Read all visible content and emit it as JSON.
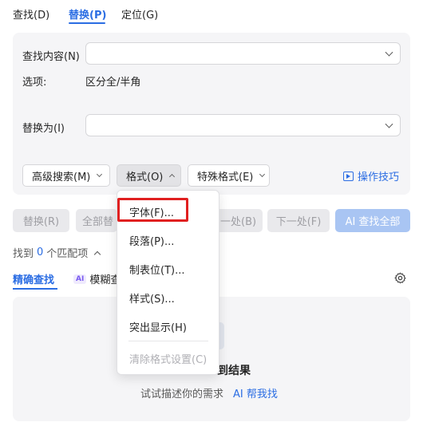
{
  "tabs": [
    {
      "label": "查找(D)"
    },
    {
      "label": "替换(P)"
    },
    {
      "label": "定位(G)"
    }
  ],
  "replace_panel": {
    "find_label": "查找内容(N)",
    "find_value": "",
    "options_label": "选项:",
    "options_value": "区分全/半角",
    "replace_label": "替换为(I)",
    "replace_value": ""
  },
  "toolbar": {
    "advanced_search": "高级搜索(M)",
    "format": "格式(O)",
    "special_format": "特殊格式(E)",
    "tips": "操作技巧"
  },
  "actions": {
    "replace": "替换(R)",
    "replace_all_partial": "全部替",
    "prev_partial": "一处(B)",
    "next": "下一处(F)",
    "ai_find_all": "AI 查找全部"
  },
  "results_summary": {
    "prefix": "找到",
    "count": "0",
    "suffix": "个匹配项"
  },
  "search_modes": {
    "exact": "精确查找",
    "ai_badge": "AI",
    "fuzzy_partial": "模糊查"
  },
  "empty_state": {
    "title_partial": "到结果",
    "hint": "试试描述你的需求",
    "ai_help": "AI 帮我找"
  },
  "format_menu": {
    "items": [
      "字体(F)...",
      "段落(P)...",
      "制表位(T)...",
      "样式(S)...",
      "突出显示(H)"
    ],
    "disabled_item": "清除格式设置(C)"
  },
  "colors": {
    "accent": "#2b6de3",
    "panel_bg": "#f5f5f7",
    "highlight": "#e02020",
    "ai_button": "#a9c5f3"
  }
}
